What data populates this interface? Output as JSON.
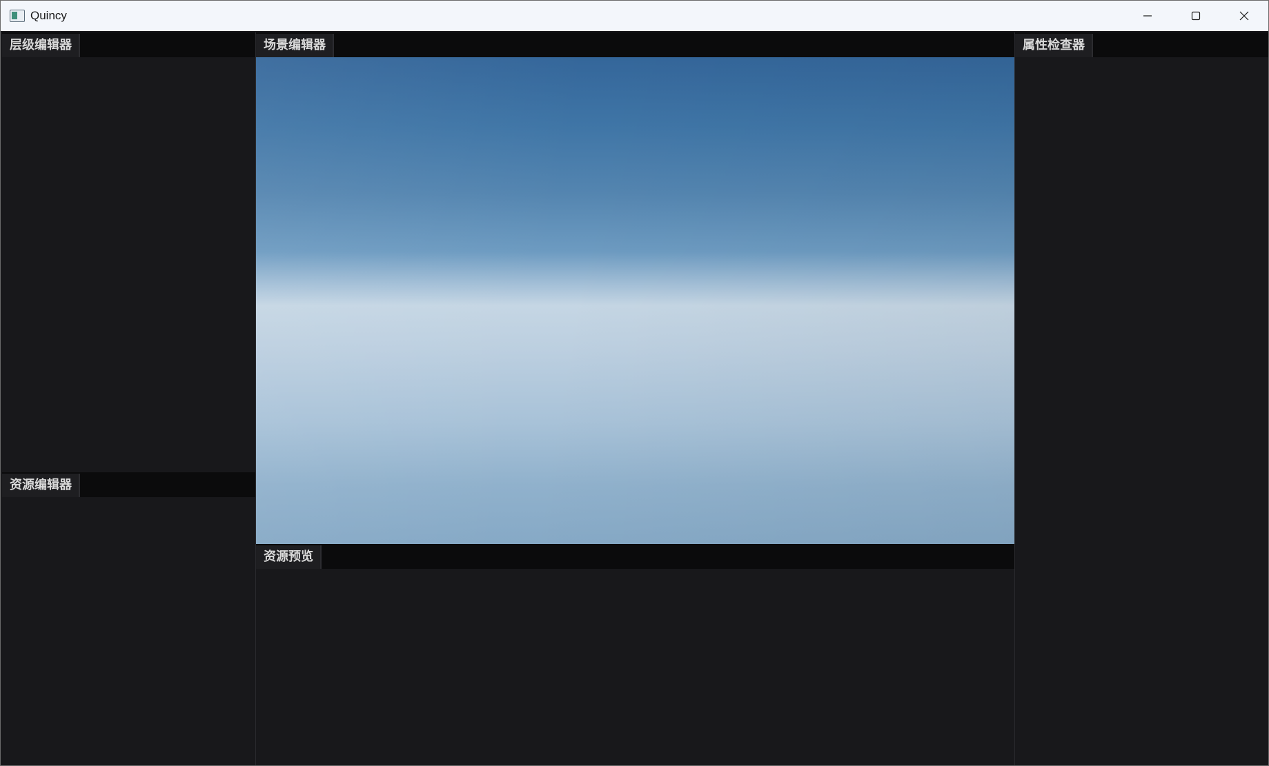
{
  "window": {
    "title": "Quincy",
    "icon": "app-window-icon"
  },
  "caption_buttons": {
    "minimize": "minimize-icon",
    "maximize": "maximize-icon",
    "close": "close-icon"
  },
  "panels": {
    "hierarchy": {
      "tab_label": "层级编辑器"
    },
    "scene": {
      "tab_label": "场景编辑器"
    },
    "inspector": {
      "tab_label": "属性检查器"
    },
    "assets": {
      "tab_label": "资源编辑器"
    },
    "preview": {
      "tab_label": "资源预览"
    }
  },
  "colors": {
    "titlebar": "#f3f6fb",
    "panel_bg": "#18181b",
    "tabstrip_bg": "#0b0b0c",
    "tab_bg": "#1e1e21",
    "tab_text": "#d9d9d9",
    "sky_top": "#34669a",
    "sky_horizon": "#c5d6e4",
    "sky_bottom": "#86a9c6"
  }
}
